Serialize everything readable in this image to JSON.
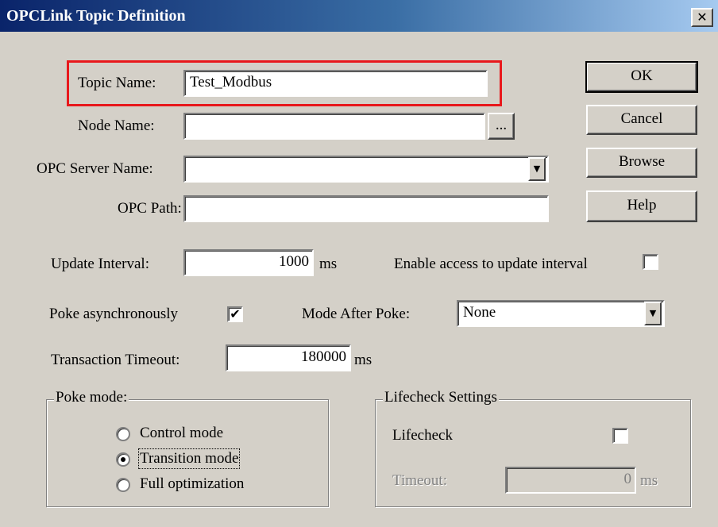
{
  "window": {
    "title": "OPCLink Topic Definition",
    "close_glyph": "✕"
  },
  "form": {
    "topic_name": {
      "label": "Topic Name:",
      "value": "Test_Modbus"
    },
    "node_name": {
      "label": "Node Name:",
      "value": "",
      "browse_label": "..."
    },
    "opc_server_name": {
      "label": "OPC Server Name:",
      "value": ""
    },
    "opc_path": {
      "label": "OPC Path:",
      "value": ""
    },
    "update_interval": {
      "label": "Update Interval:",
      "value": "1000",
      "unit": "ms"
    },
    "enable_access": {
      "label": "Enable access to update interval",
      "checked": false
    },
    "poke_async": {
      "label": "Poke asynchronously",
      "checked": true
    },
    "mode_after_poke": {
      "label": "Mode After Poke:",
      "value": "None"
    },
    "transaction_timeout": {
      "label": "Transaction Timeout:",
      "value": "180000",
      "unit": "ms"
    }
  },
  "buttons": {
    "ok": "OK",
    "cancel": "Cancel",
    "browse": "Browse",
    "help": "Help"
  },
  "poke_mode": {
    "title": "Poke mode:",
    "options": [
      {
        "label": "Control mode",
        "selected": false
      },
      {
        "label": "Transition mode",
        "selected": true
      },
      {
        "label": "Full optimization",
        "selected": false
      }
    ]
  },
  "lifecheck": {
    "title": "Lifecheck Settings",
    "label": "Lifecheck",
    "checked": false,
    "timeout_label": "Timeout:",
    "timeout_value": "0",
    "timeout_unit": "ms"
  },
  "colors": {
    "highlight_border": "#e8181c",
    "dialog_face": "#d4d0c8",
    "title_bar": "#0a246a"
  },
  "icons": {
    "dropdown": "chevron-down-icon",
    "check": "check-icon"
  }
}
